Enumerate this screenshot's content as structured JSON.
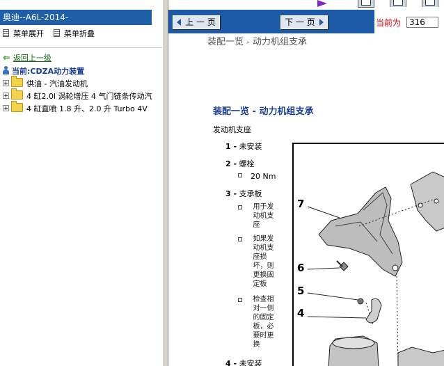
{
  "left": {
    "title": "奥迪--A6L-2014-",
    "expand_label": "菜单展开",
    "collapse_label": "菜单折叠",
    "back_label": "返回上一级",
    "current_label": "当前:CDZA动力装置",
    "tree": [
      {
        "label": "供油 - 汽油发动机"
      },
      {
        "label": "4 缸2.0l 涡轮增压 4 气门链条传动汽"
      },
      {
        "label": "4 缸直喷 1.8 升、2.0 升 Turbo 4V"
      }
    ]
  },
  "nav": {
    "prev_label": "上 一 页",
    "next_label": "下 一 页",
    "current_label": "当前为",
    "current_page": "316"
  },
  "doc": {
    "sub_heading": "装配一览 - 动力机组支承",
    "section_title": "装配一览 - 动力机组支承",
    "group_label": "发动机支座",
    "items": [
      {
        "num": "1 -",
        "label": "未安装"
      },
      {
        "num": "2 -",
        "label": "螺栓"
      },
      {
        "num": "3 -",
        "label": "支承板"
      },
      {
        "num": "4 -",
        "label": "未安装"
      }
    ],
    "bolt_torque": "20 Nm",
    "notes": [
      "用于发动机支座",
      "如果发动机支座损坏，则更换固定板",
      "检查相对一侧的固定板，必要时更换"
    ]
  },
  "figure": {
    "callouts": [
      "7",
      "6",
      "5",
      "4"
    ]
  }
}
